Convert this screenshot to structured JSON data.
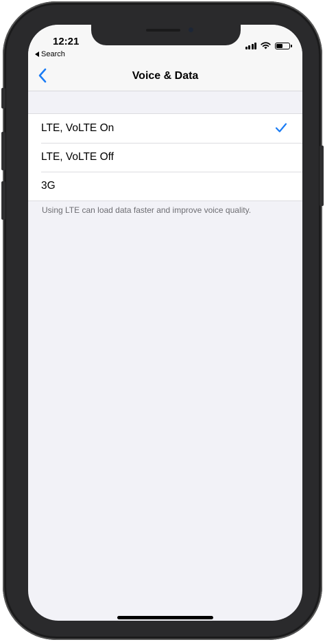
{
  "status_bar": {
    "time": "12:21",
    "back_app_label": "Search",
    "signal_icon": "cellular-signal-icon",
    "wifi_icon": "wifi-icon",
    "battery_icon": "battery-icon",
    "battery_level": 0.5
  },
  "nav": {
    "back_icon": "chevron-left-icon",
    "title": "Voice & Data"
  },
  "options": [
    {
      "label": "LTE, VoLTE On",
      "selected": true
    },
    {
      "label": "LTE, VoLTE Off",
      "selected": false
    },
    {
      "label": "3G",
      "selected": false
    }
  ],
  "footer_note": "Using LTE can load data faster and improve voice quality.",
  "colors": {
    "accent": "#1a7cf5",
    "background": "#f2f2f7",
    "frame": "#2a2a2c"
  }
}
